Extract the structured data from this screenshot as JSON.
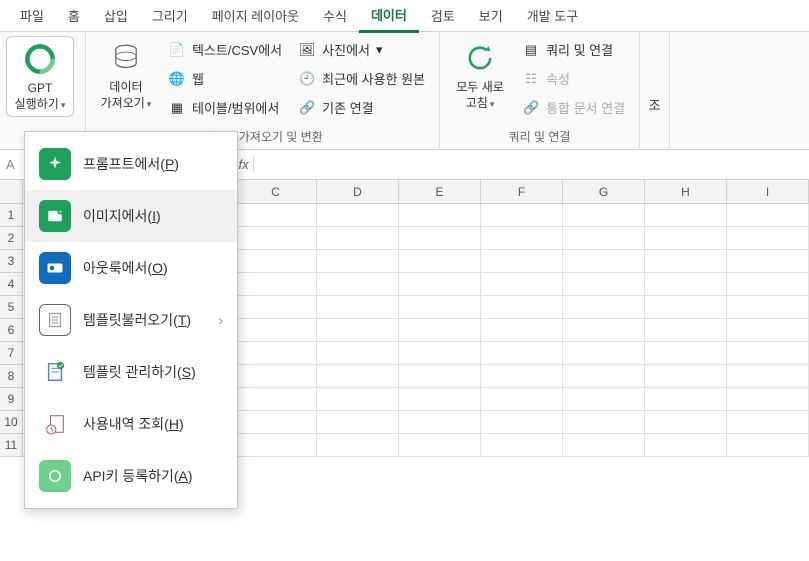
{
  "tabs": {
    "file": "파일",
    "home": "홈",
    "insert": "삽입",
    "draw": "그리기",
    "pageLayout": "페이지 레이아웃",
    "formulas": "수식",
    "data": "데이터",
    "review": "검토",
    "view": "보기",
    "developer": "개발 도구"
  },
  "ribbon": {
    "gpt_run": "GPT\n실행하기",
    "get_data": "데이터\n가져오기",
    "text_csv": "텍스트/CSV에서",
    "web": "웹",
    "table_range": "테이블/범위에서",
    "photo": "사진에서",
    "recent": "최근에 사용한 원본",
    "existing_conn": "기존 연결",
    "refresh_all": "모두 새로\n고침",
    "queries_conn": "쿼리 및 연결",
    "properties": "속성",
    "workbook_links": "통합 문서 연결",
    "zh_truncated": "조",
    "group_transform": "데이터 가져오기 및 변환",
    "group_queries": "쿼리 및 연결"
  },
  "menu": {
    "from_prompt": "프롬프트에서(",
    "from_prompt_key": "P",
    "from_prompt_close": ")",
    "from_image": "이미지에서(",
    "from_image_key": "I",
    "from_image_close": ")",
    "from_outlook": "아웃룩에서(",
    "from_outlook_key": "O",
    "from_outlook_close": ")",
    "load_template": "템플릿불러오기(",
    "load_template_key": "T",
    "load_template_close": ")",
    "manage_template": "템플릿 관리하기(",
    "manage_template_key": "S",
    "manage_template_close": ")",
    "usage_history": "사용내역 조회(",
    "usage_history_key": "H",
    "usage_history_close": ")",
    "register_api": "API키 등록하기(",
    "register_api_key": "A",
    "register_api_close": ")"
  },
  "namebox": {
    "value": "A"
  },
  "fx": {
    "label": "fx"
  },
  "cols": [
    "C",
    "D",
    "E",
    "F",
    "G",
    "H",
    "I"
  ],
  "rows": [
    "1",
    "2",
    "3",
    "4",
    "5",
    "6",
    "7",
    "8",
    "9",
    "10",
    "11"
  ]
}
